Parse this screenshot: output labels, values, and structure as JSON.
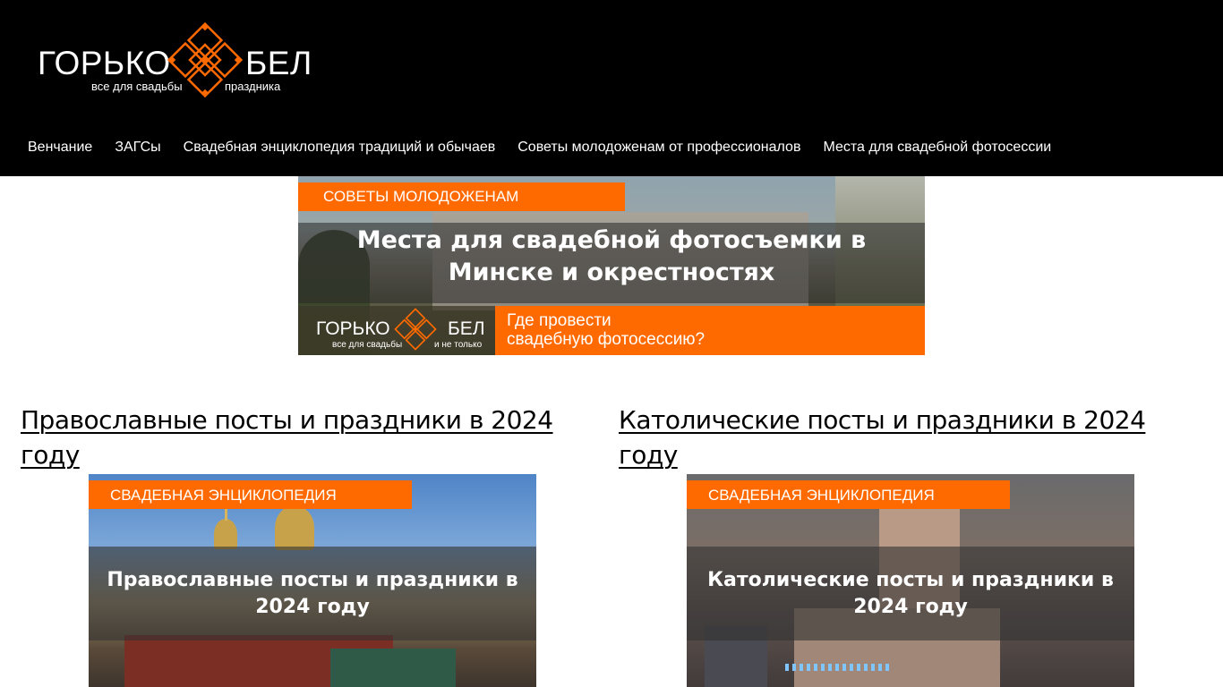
{
  "header": {
    "logo": {
      "word_left": "ГОРЬКО",
      "word_right": "БЕЛ",
      "sub_left": "все для свадьбы",
      "sub_right": "праздника"
    },
    "nav": [
      {
        "label": "Венчание"
      },
      {
        "label": "ЗАГСы"
      },
      {
        "label": "Свадебная энциклопедия традиций и обычаев"
      },
      {
        "label": "Советы молодоженам от профессионалов"
      },
      {
        "label": "Места для свадебной фотосессии"
      }
    ]
  },
  "banner": {
    "tag": "Советы молодоженам",
    "title": "Места для свадебной фотосъемки в Минске и окрестностях",
    "cta_line1": "Где провести",
    "cta_line2": "свадебную фотосессию?",
    "mini_logo": {
      "word_left": "ГОРЬКО",
      "word_right": "БЕЛ",
      "sub_left": "все для свадьбы",
      "sub_right": "и не только"
    }
  },
  "articles": [
    {
      "title": "Православные посты и праздники в 2024 году",
      "card_tag": "Свадебная энциклопедия",
      "card_title": "Православные посты и праздники в 2024 году"
    },
    {
      "title": "Католические посты и праздники в 2024 году",
      "card_tag": "Свадебная энциклопедия",
      "card_title": "Католические посты и праздники в 2024 году"
    }
  ],
  "colors": {
    "header_bg": "#000000",
    "accent": "#ff6a00",
    "text_light": "#ffffff"
  },
  "icons": {
    "logo_mark": "ornament-diamond-icon"
  }
}
